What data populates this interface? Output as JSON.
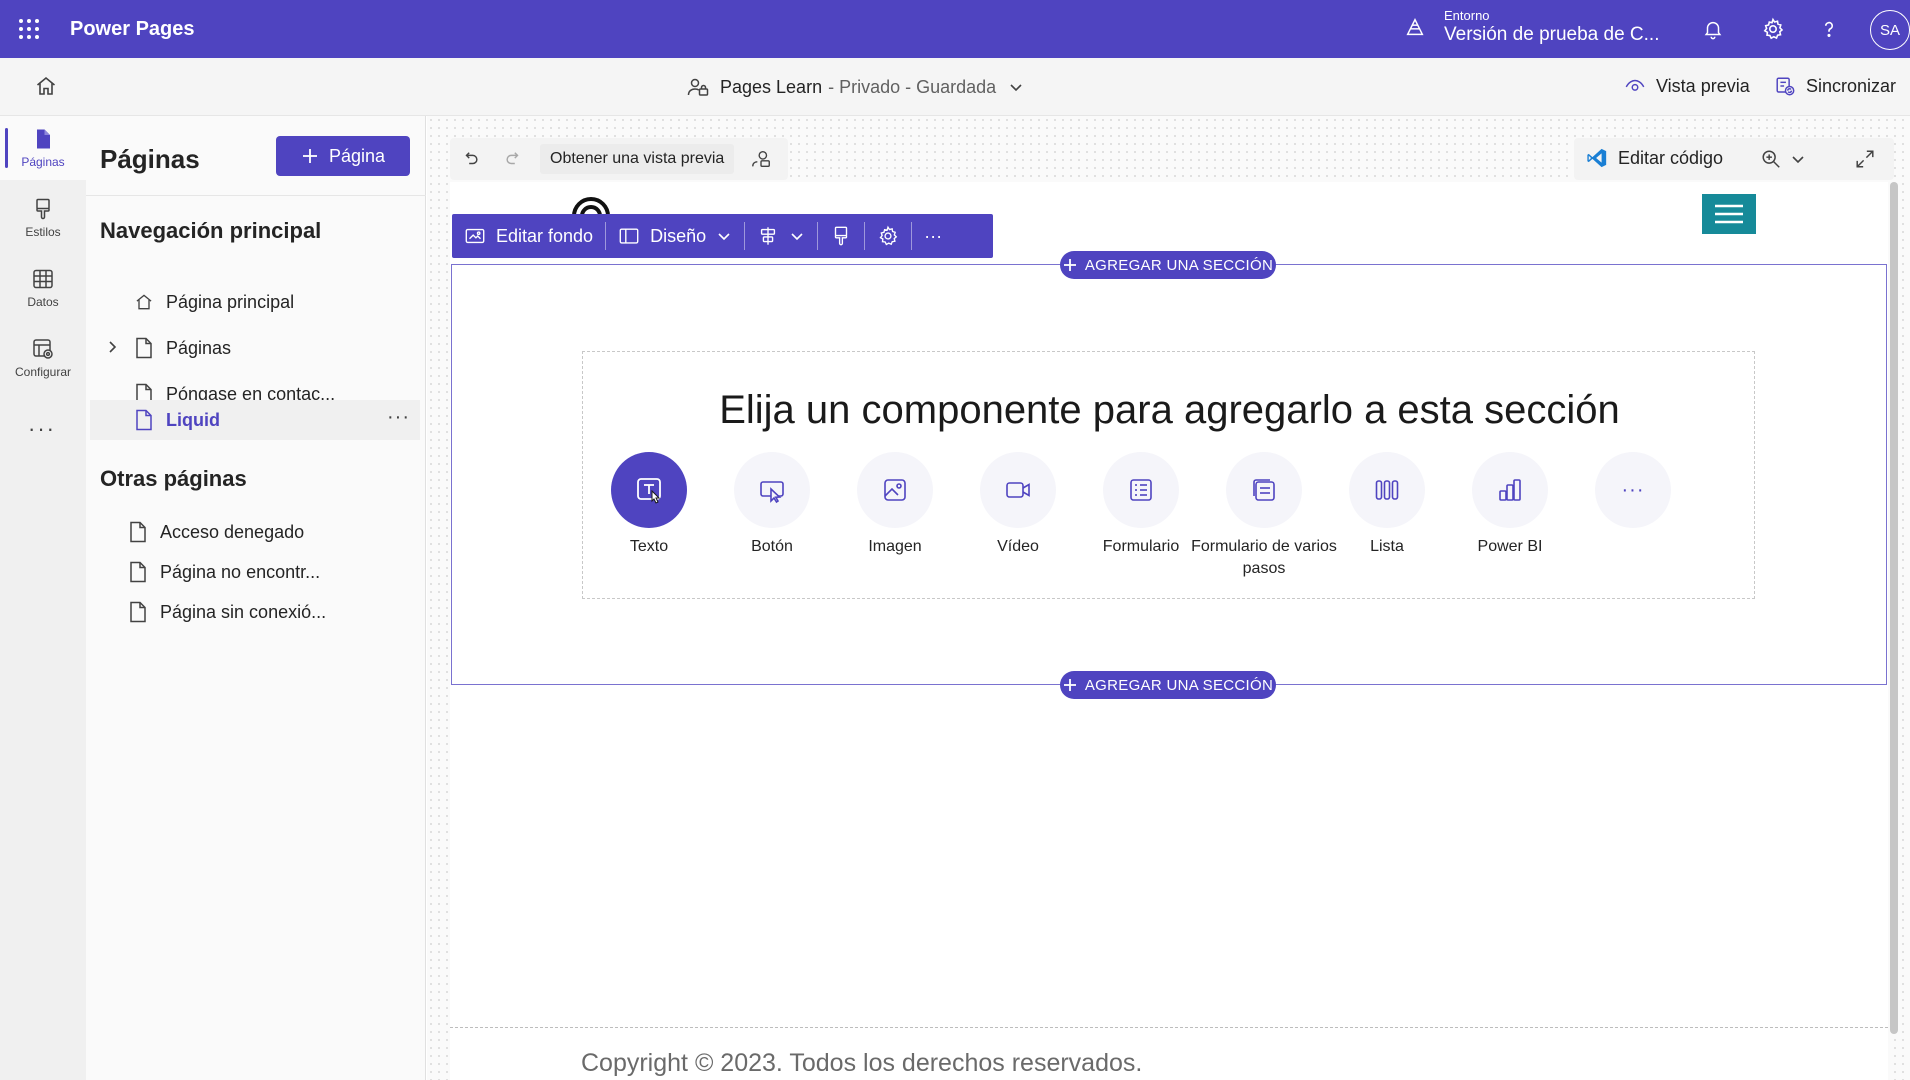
{
  "app": {
    "name": "Power Pages",
    "environment_label": "Entorno",
    "environment_value": "Versión de prueba de C...",
    "user_initials": "SA"
  },
  "commandbar": {
    "site_name": "Pages Learn",
    "site_meta": "- Privado - Guardada",
    "preview": "Vista previa",
    "sync": "Sincronizar"
  },
  "rail": [
    {
      "label": "Páginas",
      "icon": "page-icon"
    },
    {
      "label": "Estilos",
      "icon": "brush-icon"
    },
    {
      "label": "Datos",
      "icon": "table-icon"
    },
    {
      "label": "Configurar",
      "icon": "settings-grid-icon"
    }
  ],
  "rail_more": "···",
  "panel": {
    "title": "Páginas",
    "add_page": "Página",
    "main_nav_title": "Navegación principal",
    "main_nav": [
      {
        "label": "Página principal",
        "icon": "home-icon"
      },
      {
        "label": "Páginas",
        "icon": "page-icon"
      },
      {
        "label": "Póngase en contac...",
        "icon": "page-icon"
      },
      {
        "label": "Liquid",
        "icon": "page-icon"
      }
    ],
    "other_title": "Otras páginas",
    "other": [
      {
        "label": "Acceso denegado"
      },
      {
        "label": "Página no encontr..."
      },
      {
        "label": "Página sin conexió..."
      }
    ],
    "item_more": "···"
  },
  "canvas_toolbar": {
    "preview": "Obtener una vista previa",
    "edit_code": "Editar código"
  },
  "section_toolbar": {
    "edit_background": "Editar fondo",
    "layout": "Diseño",
    "more": "···"
  },
  "add_section": "AGREGAR UNA SECCIÓN",
  "picker": {
    "title": "Elija un componente para agregarlo a esta sección",
    "components": [
      {
        "label": "Texto",
        "icon": "text-icon"
      },
      {
        "label": "Botón",
        "icon": "button-icon"
      },
      {
        "label": "Imagen",
        "icon": "image-icon"
      },
      {
        "label": "Vídeo",
        "icon": "video-icon"
      },
      {
        "label": "Formulario",
        "icon": "form-icon"
      },
      {
        "label": "Formulario de varios pasos",
        "icon": "multistep-form-icon"
      },
      {
        "label": "Lista",
        "icon": "list-icon"
      },
      {
        "label": "Power BI",
        "icon": "powerbi-icon"
      }
    ],
    "more": "···"
  },
  "footer": {
    "copyright": "Copyright © 2023. Todos los derechos reservados."
  },
  "colors": {
    "brand": "#4f44c0",
    "hamburger": "#168a99"
  }
}
